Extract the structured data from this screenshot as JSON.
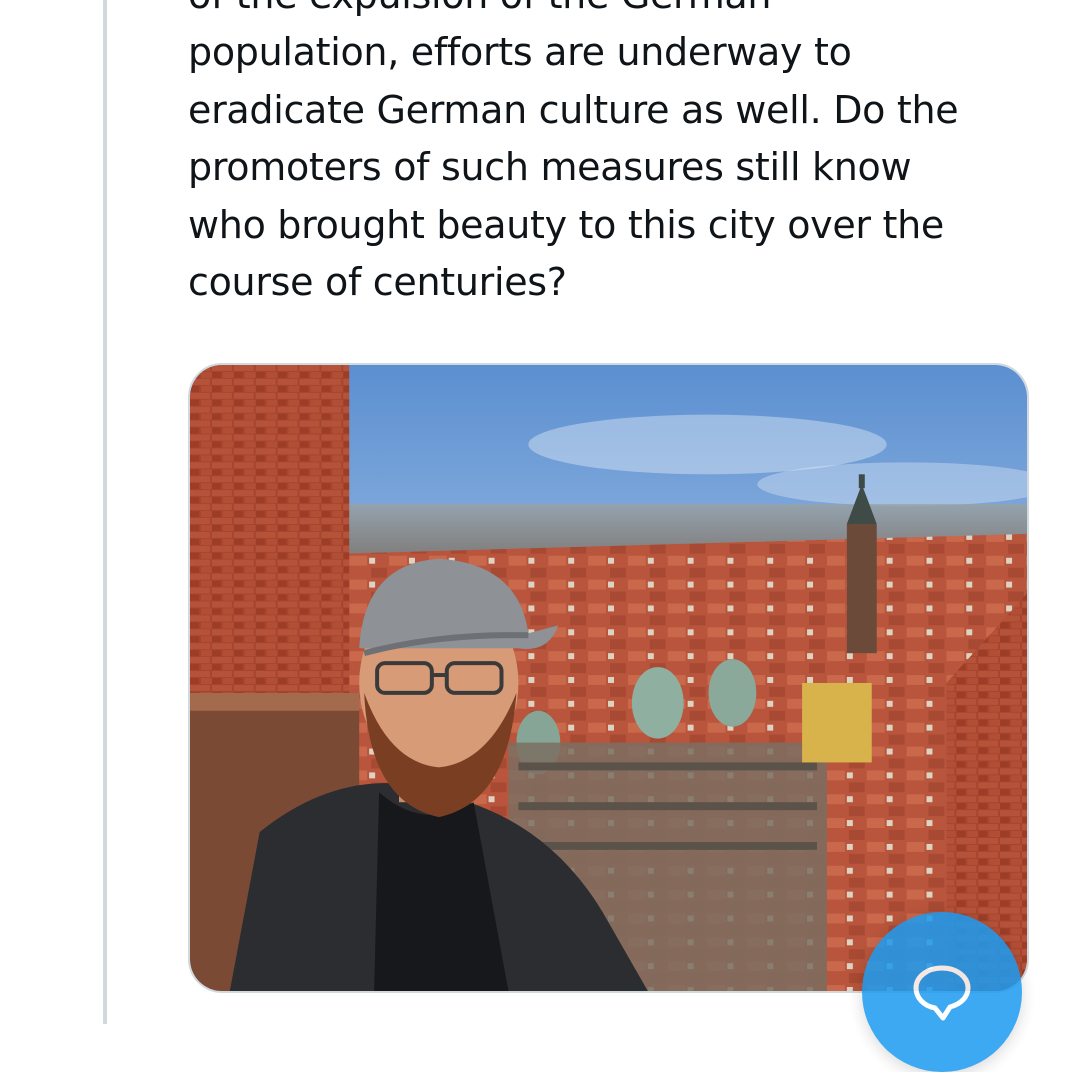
{
  "tweet": {
    "text_lines": [
      "of the expulsion of the German",
      "population, efforts are underway to",
      "eradicate German culture as well. Do the",
      "promoters of such measures still know",
      "who brought beauty to this city over the",
      "course of centuries?"
    ]
  },
  "media": {
    "kind": "photo"
  },
  "fab": {
    "icon": "reply-bubble-icon",
    "color": "#1d9bf0"
  },
  "colors": {
    "text": "#0f1419",
    "thread_line": "#cfd9de",
    "accent": "#1d9bf0"
  }
}
